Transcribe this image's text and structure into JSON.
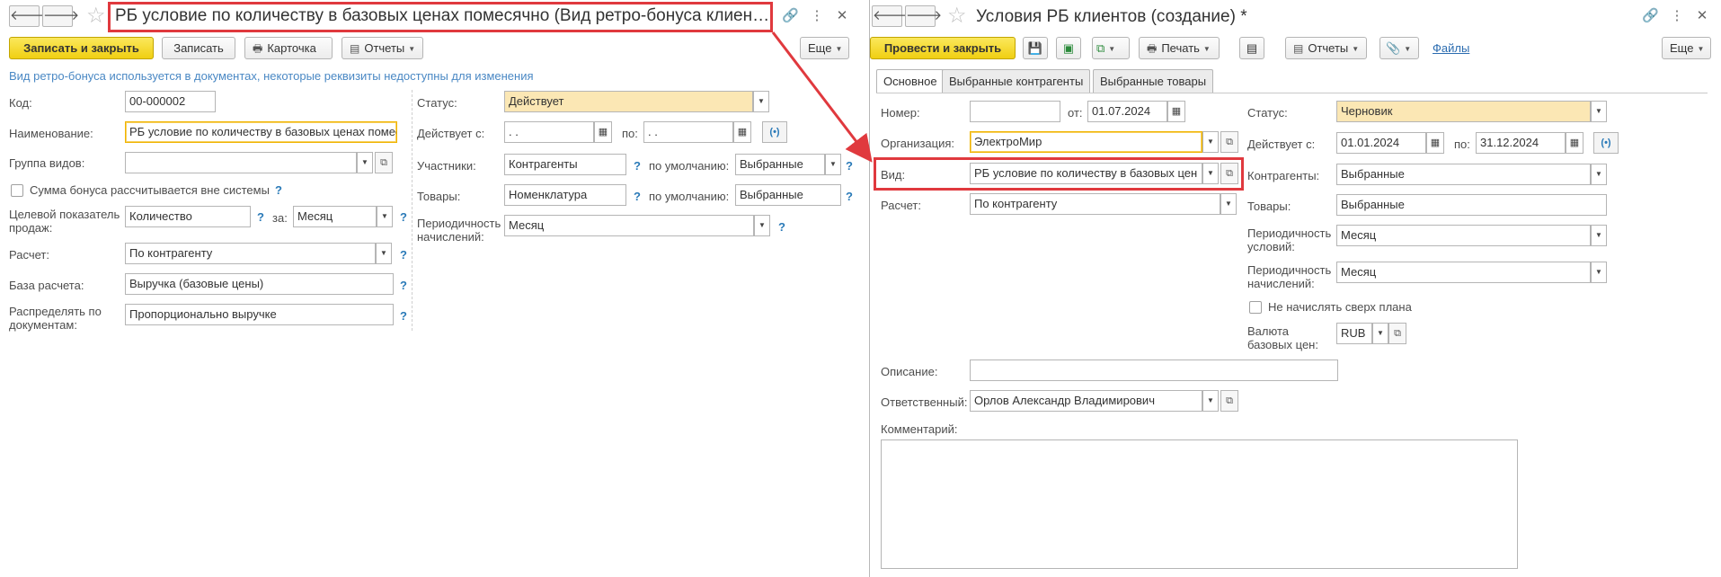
{
  "left": {
    "title": "РБ условие по количеству в базовых ценах помесячно (Вид ретро-бонуса клиент…",
    "toolbar": {
      "save_close": "Записать и закрыть",
      "save": "Записать",
      "card": "Карточка",
      "reports": "Отчеты",
      "more": "Еще"
    },
    "info_text": "Вид ретро-бонуса используется в документах, некоторые реквизиты недоступны для изменения",
    "fields": {
      "code_label": "Код:",
      "code_value": "00-000002",
      "name_label": "Наименование:",
      "name_value": "РБ условие по количеству в базовых ценах помесячно",
      "group_label": "Группа видов:",
      "group_value": "",
      "outside_label": "Сумма бонуса рассчитывается вне системы",
      "target_label": "Целевой показатель продаж:",
      "target_value": "Количество",
      "per_label": "за:",
      "per_value": "Месяц",
      "calc_label": "Расчет:",
      "calc_value": "По контрагенту",
      "base_label": "База расчета:",
      "base_value": "Выручка (базовые цены)",
      "distribute_label": "Распределять по документам:",
      "distribute_value": "Пропорционально выручке",
      "status_label": "Статус:",
      "status_value": "Действует",
      "valid_from_label": "Действует с:",
      "valid_from_value": " .  .",
      "valid_to_label": "по:",
      "valid_to_value": " .  .",
      "participants_label": "Участники:",
      "participants_value": "Контрагенты",
      "default_label": "по умолчанию:",
      "participants_default": "Выбранные",
      "goods_label": "Товары:",
      "goods_value": "Номенклатура",
      "goods_default": "Выбранные",
      "period_label": "Периодичность начислений:",
      "period_value": "Месяц",
      "q": "?"
    }
  },
  "right": {
    "title": "Условия РБ клиентов (создание) *",
    "toolbar": {
      "post_close": "Провести и закрыть",
      "print": "Печать",
      "reports": "Отчеты",
      "files": "Файлы",
      "more": "Еще"
    },
    "tabs": [
      "Основное",
      "Выбранные контрагенты",
      "Выбранные товары"
    ],
    "fields": {
      "number_label": "Номер:",
      "number_value": "",
      "date_label": "от:",
      "date_value": "01.07.2024",
      "org_label": "Организация:",
      "org_value": "ЭлектроМир",
      "kind_label": "Вид:",
      "kind_value": "РБ условие по количеству в базовых цен",
      "calc_label": "Расчет:",
      "calc_value": "По контрагенту",
      "status_label": "Статус:",
      "status_value": "Черновик",
      "valid_from_label": "Действует с:",
      "valid_from_value": "01.01.2024",
      "valid_to_label": "по:",
      "valid_to_value": "31.12.2024",
      "counterparties_label": "Контрагенты:",
      "counterparties_value": "Выбранные",
      "goods_label": "Товары:",
      "goods_value": "Выбранные",
      "cond_period_label": "Периодичность условий:",
      "cond_period_value": "Месяц",
      "acc_period_label": "Периодичность начислений:",
      "acc_period_value": "Месяц",
      "no_over_plan_label": "Не начислять сверх плана",
      "currency_label": "Валюта базовых цен:",
      "currency_value": "RUB",
      "description_label": "Описание:",
      "description_value": "",
      "responsible_label": "Ответственный:",
      "responsible_value": "Орлов Александр Владимирович",
      "comment_label": "Комментарий:"
    }
  },
  "colors": {
    "accent_yellow": "#f0cf12",
    "highlight_red": "#e0393e",
    "status_bg": "#fbe7b4"
  },
  "icons": [
    "back-arrow-icon",
    "forward-arrow-icon",
    "star-icon",
    "link-icon",
    "more-vert-icon",
    "close-icon",
    "printer-icon",
    "report-icon",
    "save-icon",
    "attach-icon",
    "calendar-icon",
    "dropdown-icon",
    "open-icon"
  ]
}
